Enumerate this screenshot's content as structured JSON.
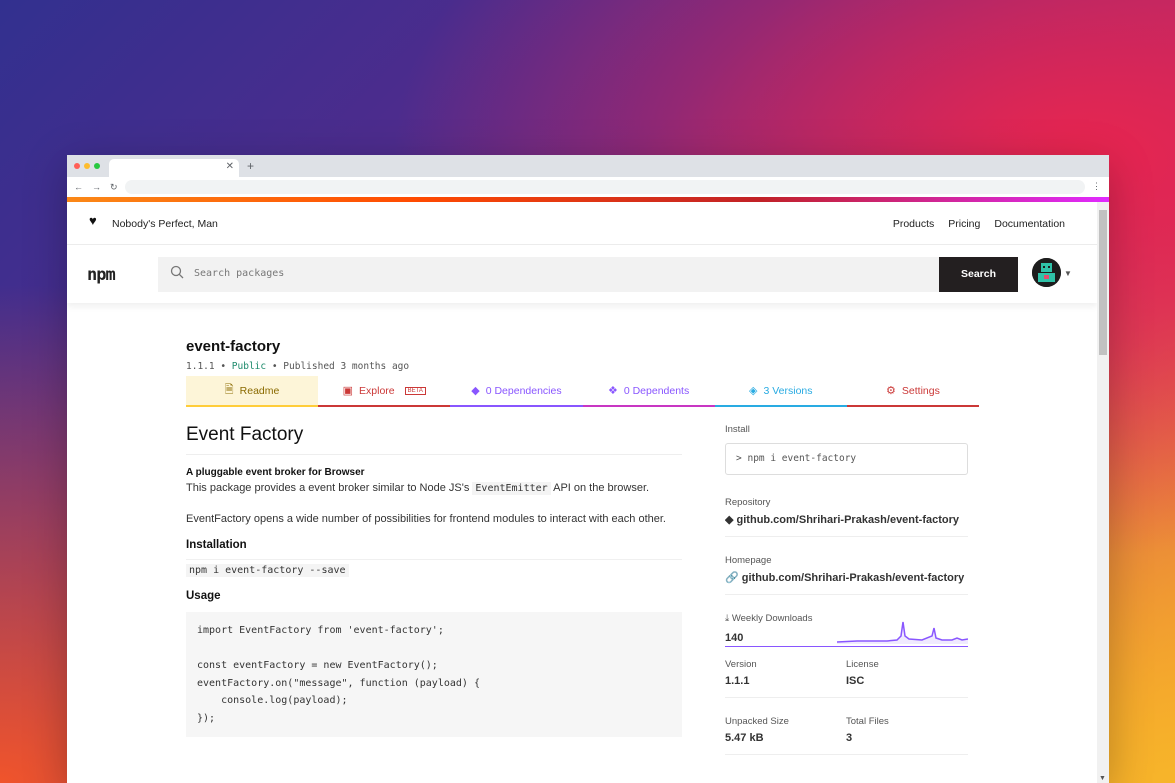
{
  "site": {
    "tagline": "Nobody's Perfect, Man",
    "nav": [
      "Products",
      "Pricing",
      "Documentation"
    ],
    "logo": "npm",
    "search_placeholder": "Search packages",
    "search_button": "Search"
  },
  "package": {
    "name": "event-factory",
    "version": "1.1.1",
    "visibility": "Public",
    "published": "Published 3 months ago"
  },
  "tabs": [
    {
      "label": "Readme",
      "icon": "readme-icon",
      "color": "#cc9a06"
    },
    {
      "label": "Explore",
      "icon": "explore-icon",
      "color": "#cb3837",
      "badge": "BETA"
    },
    {
      "label": "0 Dependencies",
      "icon": "cube-icon",
      "color": "#8956ff"
    },
    {
      "label": "0 Dependents",
      "icon": "cubes-icon",
      "color": "#8956ff"
    },
    {
      "label": "3 Versions",
      "icon": "tag-icon",
      "color": "#29abe2"
    },
    {
      "label": "Settings",
      "icon": "gear-icon",
      "color": "#cb3837"
    }
  ],
  "readme": {
    "title": "Event Factory",
    "subtitle": "A pluggable event broker for Browser",
    "p1_before": "This package provides a event broker similar to Node JS's ",
    "p1_code": "EventEmitter",
    "p1_after": " API on the browser.",
    "p2": "EventFactory opens a wide number of possibilities for frontend modules to interact with each other.",
    "installation_heading": "Installation",
    "install_cmd": "npm i event-factory --save",
    "usage_heading": "Usage",
    "code": "import EventFactory from 'event-factory';\n\nconst eventFactory = new EventFactory();\neventFactory.on(\"message\", function (payload) {\n    console.log(payload);\n});"
  },
  "sidebar": {
    "install_label": "Install",
    "install_cmd": "npm i event-factory",
    "repository_label": "Repository",
    "repository": "github.com/Shrihari-Prakash/event-factory",
    "homepage_label": "Homepage",
    "homepage": "github.com/Shrihari-Prakash/event-factory",
    "weekly_downloads_label": "Weekly Downloads",
    "weekly_downloads": "140",
    "version_label": "Version",
    "version": "1.1.1",
    "license_label": "License",
    "license": "ISC",
    "unpacked_size_label": "Unpacked Size",
    "unpacked_size": "5.47 kB",
    "total_files_label": "Total Files",
    "total_files": "3"
  },
  "colors": {
    "accent": "#cb3837",
    "sparkline": "#8956ff"
  }
}
